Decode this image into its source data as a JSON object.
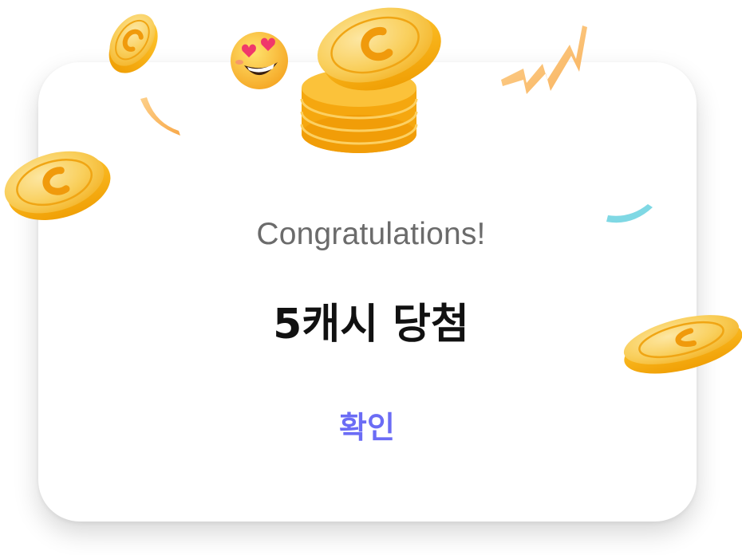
{
  "dialog": {
    "greeting": "Congratulations!",
    "prize_text": "5캐시 당첨",
    "confirm_label": "확인"
  },
  "decorations": {
    "coin_icon": "coin-icon",
    "coin_stack_icon": "coin-stack-icon",
    "emoji_icon": "heart-eyes-emoji-icon",
    "confetti_icon": "confetti-ribbon-icon"
  },
  "colors": {
    "accent": "#6b6cf5",
    "coin_gold": "#f7b416",
    "coin_face": "#f9d266",
    "confetti_orange": "#fbc46a",
    "confetti_teal": "#7fd8e4"
  }
}
